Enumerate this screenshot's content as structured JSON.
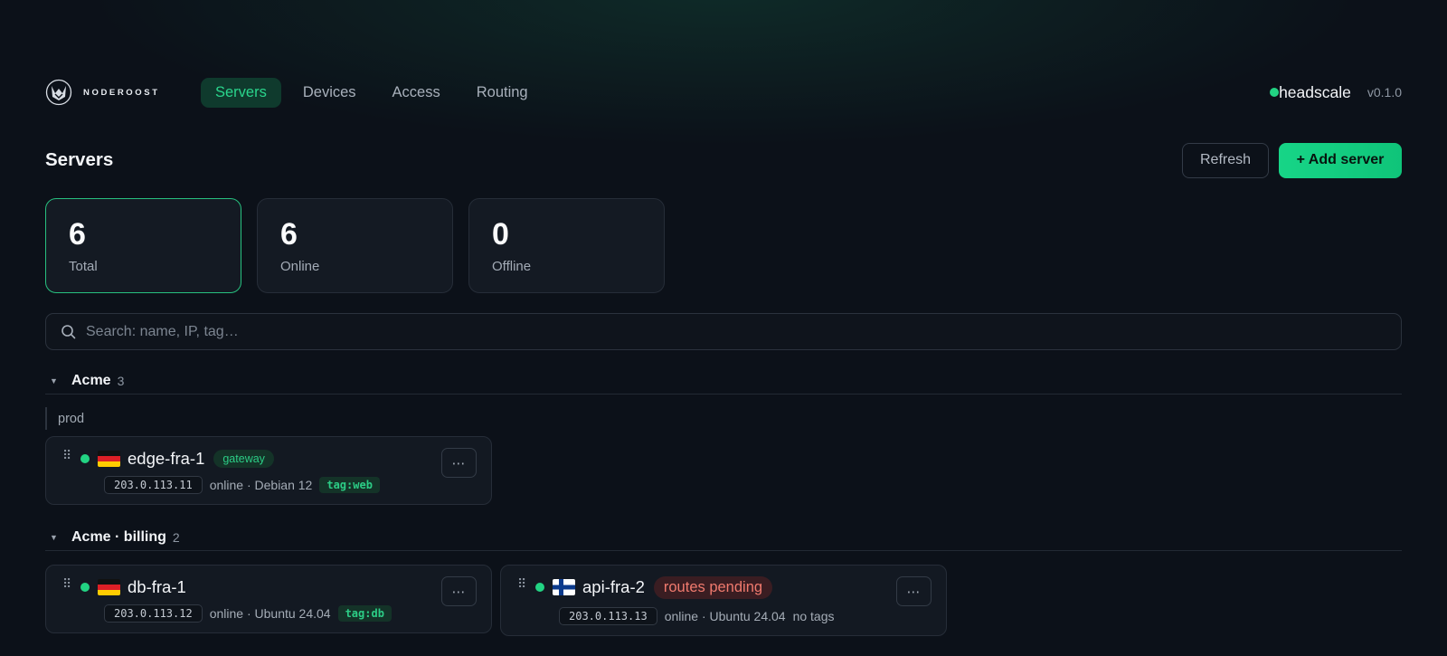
{
  "header": {
    "brand": "NODEROOST",
    "nav": [
      {
        "label": "Servers",
        "active": true
      },
      {
        "label": "Devices"
      },
      {
        "label": "Access"
      },
      {
        "label": "Routing"
      }
    ],
    "server": "headscale",
    "version": "v0.1.0"
  },
  "page": {
    "title": "Servers",
    "refresh_label": "Refresh",
    "add_label": "+ Add server"
  },
  "stats": [
    {
      "value": "6",
      "label": "Total"
    },
    {
      "value": "6",
      "label": "Online"
    },
    {
      "value": "0",
      "label": "Offline"
    }
  ],
  "search": {
    "placeholder": "Search: name, IP, tag…"
  },
  "groups": [
    {
      "name": "Acme",
      "count": "3",
      "subgroup": "prod"
    },
    {
      "name": "Acme · billing",
      "count": "2"
    }
  ],
  "servers": [
    {
      "name": "edge-fra-1",
      "flag": "germany-flag",
      "badge": "gateway",
      "ip": "203.0.113.11",
      "meta": "online · Debian 12",
      "tag": "tag:web"
    },
    {
      "name": "db-fra-1",
      "flag": "germany-flag",
      "ip": "203.0.113.12",
      "meta": "online · Ubuntu 24.04",
      "tag": "tag:db"
    },
    {
      "name": "api-fra-2",
      "flag": "finland-flag",
      "badge": "routes pending",
      "ip": "203.0.113.13",
      "meta": "online · Ubuntu 24.04",
      "notags": "no tags"
    }
  ],
  "more_label": "⋯",
  "colors": {
    "accent": "#22d383",
    "background": "#0c1119",
    "warning": "#f07a6e"
  }
}
